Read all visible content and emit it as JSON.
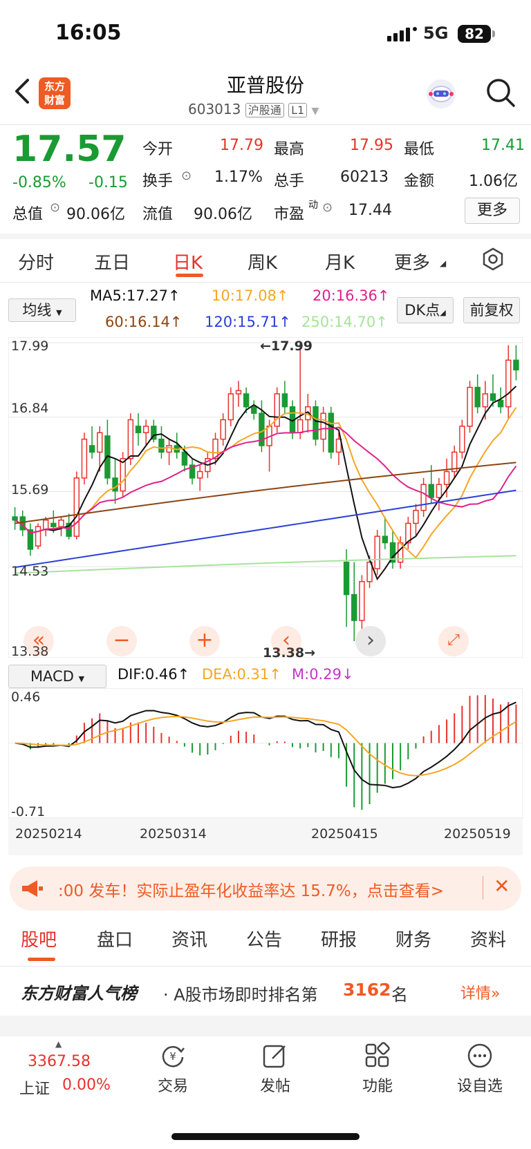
{
  "status": {
    "time": "16:05",
    "network": "5G",
    "battery": "82"
  },
  "header": {
    "title": "亚普股份",
    "code": "603013",
    "tag1": "沪股通",
    "tag2": "L1",
    "logo_line1": "东方",
    "logo_line2": "财富"
  },
  "quote": {
    "price": "17.57",
    "change_pct": "-0.85%",
    "change": "-0.15",
    "open_label": "今开",
    "open": "17.79",
    "high_label": "最高",
    "high": "17.95",
    "low_label": "最低",
    "low": "17.41",
    "turnover_label": "换手",
    "turnover": "1.17%",
    "volume_label": "总手",
    "volume": "60213",
    "amount_label": "金额",
    "amount": "1.06亿",
    "mktcap_label": "总值",
    "mktcap": "90.06亿",
    "float_label": "流值",
    "float": "90.06亿",
    "pe_label": "市盈",
    "pe_sup": "动",
    "pe": "17.44",
    "more": "更多"
  },
  "tabs": [
    "分时",
    "五日",
    "日K",
    "周K",
    "月K",
    "更多"
  ],
  "ma": {
    "selector": "均线",
    "ma5": "MA5:17.27↑",
    "ma10": "10:17.08↑",
    "ma20": "20:16.36↑",
    "ma60": "60:16.14↑",
    "ma120": "120:15.71↑",
    "ma250": "250:14.70↑",
    "dk": "DK点",
    "fq": "前复权",
    "colors": {
      "ma5": "#111111",
      "ma10": "#f5a623",
      "ma20": "#e0208c",
      "ma60": "#8b4513",
      "ma120": "#2a3fd6",
      "ma250": "#a6e39a"
    }
  },
  "kline": {
    "y_labels": [
      "17.99",
      "16.84",
      "15.69",
      "14.53",
      "13.38"
    ],
    "max_marker": "←17.99",
    "min_marker": "13.38→"
  },
  "macd": {
    "selector": "MACD",
    "dif": "DIF:0.46↑",
    "dea": "DEA:0.31↑",
    "m": "M:0.29↓",
    "y_top": "0.46",
    "y_bottom": "-0.71"
  },
  "dates": [
    "20250214",
    "20250314",
    "20250415",
    "20250519"
  ],
  "banner": {
    "text": ":00 发车！实际止盈年化收益率达 15.7%，点击查看>"
  },
  "bottom_tabs": [
    "股吧",
    "盘口",
    "资讯",
    "公告",
    "研报",
    "财务",
    "资料"
  ],
  "rank": {
    "brand": "东方财富人气榜",
    "text": "· A股市场即时排名第",
    "num": "3162",
    "unit": "名",
    "detail": "详情"
  },
  "dock": {
    "index_value": "3367.58",
    "index_name": "上证",
    "index_change": "0.00%",
    "trade": "交易",
    "post": "发帖",
    "func": "功能",
    "watch": "设自选"
  },
  "chart_data": {
    "type": "candlestick",
    "ylim": [
      13.38,
      17.99
    ],
    "note_labels": {
      "max": "17.99",
      "min": "13.38"
    },
    "x_ticks": [
      "20250214",
      "20250314",
      "20250415",
      "20250519"
    ],
    "candles": [
      [
        15.3,
        15.45,
        15.1,
        15.25
      ],
      [
        15.3,
        15.4,
        15.0,
        15.1
      ],
      [
        15.1,
        15.2,
        14.7,
        14.8
      ],
      [
        14.85,
        15.2,
        14.8,
        15.15
      ],
      [
        15.1,
        15.3,
        15.0,
        15.25
      ],
      [
        15.2,
        15.4,
        15.05,
        15.15
      ],
      [
        15.15,
        15.3,
        15.0,
        15.25
      ],
      [
        15.2,
        15.35,
        14.95,
        15.0
      ],
      [
        15.0,
        16.0,
        14.95,
        15.9
      ],
      [
        15.9,
        16.6,
        15.8,
        16.5
      ],
      [
        16.4,
        16.7,
        16.2,
        16.3
      ],
      [
        16.3,
        16.7,
        16.0,
        16.6
      ],
      [
        16.55,
        16.8,
        15.8,
        15.9
      ],
      [
        15.9,
        16.2,
        15.5,
        15.7
      ],
      [
        15.7,
        16.3,
        15.6,
        16.2
      ],
      [
        16.2,
        16.9,
        16.1,
        16.8
      ],
      [
        16.7,
        16.9,
        16.4,
        16.6
      ],
      [
        16.6,
        16.8,
        16.4,
        16.7
      ],
      [
        16.7,
        16.8,
        16.45,
        16.5
      ],
      [
        16.5,
        16.7,
        16.2,
        16.3
      ],
      [
        16.3,
        16.5,
        16.1,
        16.4
      ],
      [
        16.4,
        16.6,
        16.2,
        16.3
      ],
      [
        16.3,
        16.4,
        16.0,
        16.1
      ],
      [
        16.1,
        16.2,
        15.8,
        15.9
      ],
      [
        15.9,
        16.1,
        15.7,
        16.0
      ],
      [
        16.0,
        16.3,
        15.9,
        16.2
      ],
      [
        16.2,
        16.6,
        16.1,
        16.5
      ],
      [
        16.5,
        16.9,
        16.4,
        16.8
      ],
      [
        16.8,
        17.3,
        16.7,
        17.2
      ],
      [
        17.2,
        17.4,
        17.0,
        17.25
      ],
      [
        17.2,
        17.3,
        16.9,
        17.0
      ],
      [
        17.0,
        17.1,
        16.8,
        16.9
      ],
      [
        16.9,
        17.1,
        16.3,
        16.4
      ],
      [
        16.4,
        16.8,
        16.0,
        16.7
      ],
      [
        16.7,
        17.3,
        16.6,
        17.2
      ],
      [
        17.2,
        17.4,
        16.9,
        17.0
      ],
      [
        17.0,
        17.1,
        16.5,
        16.6
      ],
      [
        16.6,
        17.99,
        16.5,
        16.8
      ],
      [
        16.8,
        17.2,
        16.6,
        17.0
      ],
      [
        17.0,
        17.1,
        16.4,
        16.5
      ],
      [
        16.5,
        17.0,
        16.3,
        16.9
      ],
      [
        16.9,
        17.0,
        16.2,
        16.3
      ],
      [
        16.3,
        16.6,
        16.1,
        16.5
      ],
      [
        14.6,
        14.8,
        13.6,
        14.1
      ],
      [
        14.1,
        14.6,
        13.38,
        13.7
      ],
      [
        13.7,
        14.4,
        13.5,
        14.3
      ],
      [
        14.3,
        14.7,
        14.2,
        14.6
      ],
      [
        14.5,
        15.1,
        14.4,
        15.0
      ],
      [
        15.0,
        15.3,
        14.8,
        14.9
      ],
      [
        14.9,
        15.1,
        14.5,
        14.6
      ],
      [
        14.6,
        15.0,
        14.5,
        14.9
      ],
      [
        14.9,
        15.3,
        14.8,
        15.2
      ],
      [
        15.2,
        15.5,
        15.0,
        15.4
      ],
      [
        15.4,
        15.9,
        15.3,
        15.8
      ],
      [
        15.8,
        16.1,
        15.5,
        15.6
      ],
      [
        15.6,
        15.9,
        15.4,
        15.8
      ],
      [
        15.8,
        16.2,
        15.6,
        16.0
      ],
      [
        16.0,
        16.4,
        15.9,
        16.3
      ],
      [
        16.3,
        16.8,
        16.2,
        16.7
      ],
      [
        16.7,
        17.4,
        16.6,
        17.3
      ],
      [
        17.3,
        17.5,
        16.9,
        17.0
      ],
      [
        17.0,
        17.4,
        16.8,
        17.2
      ],
      [
        17.2,
        17.5,
        17.0,
        17.1
      ],
      [
        17.1,
        17.3,
        16.9,
        17.0
      ],
      [
        17.0,
        17.95,
        16.8,
        17.72
      ],
      [
        17.72,
        17.95,
        17.41,
        17.57
      ]
    ]
  }
}
